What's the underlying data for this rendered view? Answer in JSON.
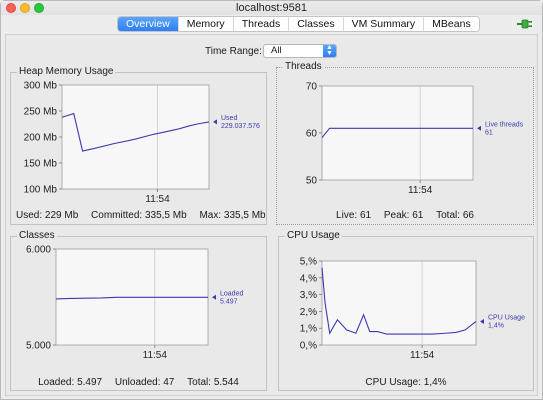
{
  "window": {
    "title": "localhost:9581"
  },
  "tabs": [
    {
      "label": "Overview",
      "active": true
    },
    {
      "label": "Memory"
    },
    {
      "label": "Threads"
    },
    {
      "label": "Classes"
    },
    {
      "label": "VM Summary"
    },
    {
      "label": "MBeans"
    }
  ],
  "time_range": {
    "label": "Time Range:",
    "value": "All"
  },
  "colors": {
    "series": "#3b3bb0",
    "accent": "#2e7ef5",
    "plot_bg": "#f7f7f7"
  },
  "icons": {
    "connect": "connection-plug-icon"
  },
  "chart_data": [
    {
      "id": "heap",
      "type": "line",
      "title": "Heap Memory Usage",
      "yticks": [
        "300 Mb",
        "250 Mb",
        "200 Mb",
        "150 Mb",
        "100 Mb"
      ],
      "ylim": [
        100,
        300
      ],
      "xtick": "11:54",
      "series": [
        {
          "name": "Used",
          "value_label": "229.037.576",
          "x": [
            0,
            0.08,
            0.14,
            0.22,
            0.35,
            0.5,
            0.62,
            0.72,
            0.8,
            0.86,
            0.92,
            1.0
          ],
          "values": [
            238,
            245,
            173,
            178,
            187,
            196,
            205,
            211,
            216,
            221,
            225,
            229
          ]
        }
      ],
      "stats": [
        {
          "label": "Used:",
          "value": "229 Mb"
        },
        {
          "label": "Committed:",
          "value": "335,5 Mb"
        },
        {
          "label": "Max:",
          "value": "335,5 Mb"
        }
      ]
    },
    {
      "id": "threads",
      "type": "line",
      "title": "Threads",
      "yticks": [
        "70",
        "60",
        "50"
      ],
      "ylim": [
        50,
        70
      ],
      "xtick": "11:54",
      "series": [
        {
          "name": "Live threads",
          "value_label": "61",
          "x": [
            0,
            0.05,
            0.06,
            1.0
          ],
          "values": [
            59,
            61,
            61,
            61
          ]
        }
      ],
      "stats": [
        {
          "label": "Live:",
          "value": "61"
        },
        {
          "label": "Peak:",
          "value": "61"
        },
        {
          "label": "Total:",
          "value": "66"
        }
      ]
    },
    {
      "id": "classes",
      "type": "line",
      "title": "Classes",
      "yticks": [
        "6.000",
        "5.000"
      ],
      "ylim": [
        5000,
        6000
      ],
      "xtick": "11:54",
      "series": [
        {
          "name": "Loaded",
          "value_label": "5.497",
          "x": [
            0,
            0.1,
            0.3,
            0.4,
            1.0
          ],
          "values": [
            5480,
            5485,
            5490,
            5497,
            5497
          ]
        }
      ],
      "stats": [
        {
          "label": "Loaded:",
          "value": "5.497"
        },
        {
          "label": "Unloaded:",
          "value": "47"
        },
        {
          "label": "Total:",
          "value": "5.544"
        }
      ]
    },
    {
      "id": "cpu",
      "type": "line",
      "title": "CPU Usage",
      "yticks": [
        "5,%",
        "4,%",
        "3,%",
        "2,%",
        "1,%",
        "0,%"
      ],
      "ylim": [
        0,
        5
      ],
      "xtick": "11:54",
      "series": [
        {
          "name": "CPU Usage",
          "value_label": "1,4%",
          "x": [
            0,
            0.02,
            0.05,
            0.1,
            0.16,
            0.22,
            0.27,
            0.31,
            0.36,
            0.42,
            0.5,
            0.6,
            0.72,
            0.8,
            0.87,
            0.93,
            1.0
          ],
          "values": [
            4.6,
            2.5,
            0.7,
            1.5,
            0.9,
            0.7,
            1.8,
            0.8,
            0.8,
            0.65,
            0.65,
            0.65,
            0.65,
            0.7,
            0.75,
            0.9,
            1.4
          ]
        }
      ],
      "stats": [
        {
          "label": "CPU Usage:",
          "value": "1,4%"
        }
      ]
    }
  ]
}
